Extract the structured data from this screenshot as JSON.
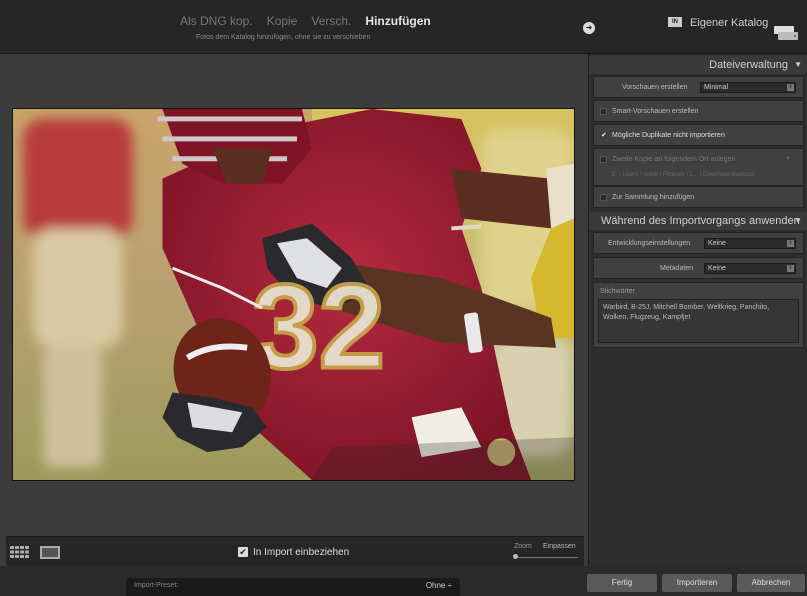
{
  "header": {
    "modes": [
      "Als DNG kop.",
      "Kopie",
      "Versch.",
      "Hinzufügen"
    ],
    "active_mode": "Hinzufügen",
    "subtitle": "Fotos dem Katalog hinzufügen, ohne sie zu verschieben",
    "destination_badge": "IN",
    "destination_label": "Eigener Katalog",
    "arrow_glyph": "➜"
  },
  "toolbar": {
    "include_label": "In Import einbeziehen",
    "include_checked": true,
    "zoom_label": "Zoom",
    "fit_label": "Einpassen",
    "zoom_level": 0
  },
  "footer": {
    "preset_label": "Import-Preset:",
    "preset_value": "Ohne ÷",
    "done_label": "Fertig",
    "import_label": "Importieren",
    "cancel_label": "Abbrechen"
  },
  "panel": {
    "file_handling": {
      "title": "Dateiverwaltung",
      "previews_label": "Vorschauen erstellen",
      "previews_value": "Minimal",
      "smart_previews_label": "Smart-Vorschauen erstellen",
      "smart_previews_checked": false,
      "duplicates_label": "Mögliche Duplikate nicht importieren",
      "duplicates_checked": true,
      "second_copy_label": "Zweite Kopie an folgendem Ort anlegen",
      "second_copy_checked": false,
      "second_copy_path": "E: \\ Users \\ nolde \\ Pictures \\ L... \\ Download-Backups",
      "collection_label": "Zur Sammlung hinzufügen",
      "collection_checked": false
    },
    "apply_during_import": {
      "title": "Während des Importvorgangs anwenden",
      "develop_label": "Entwicklungseinstellungen",
      "develop_value": "Keine",
      "metadata_label": "Metadaten",
      "metadata_value": "Keine",
      "keywords_label": "Stichwörter",
      "keywords_value": "Warbird, B-25J, Mitchell Bomber, Weltkrieg, Panchito, Wolken, Flugzeug, Kampfjet"
    }
  },
  "colors": {
    "jersey": "#a11e35",
    "background_blur": "#c9b86a",
    "panel_bg": "#2e2e2e"
  }
}
